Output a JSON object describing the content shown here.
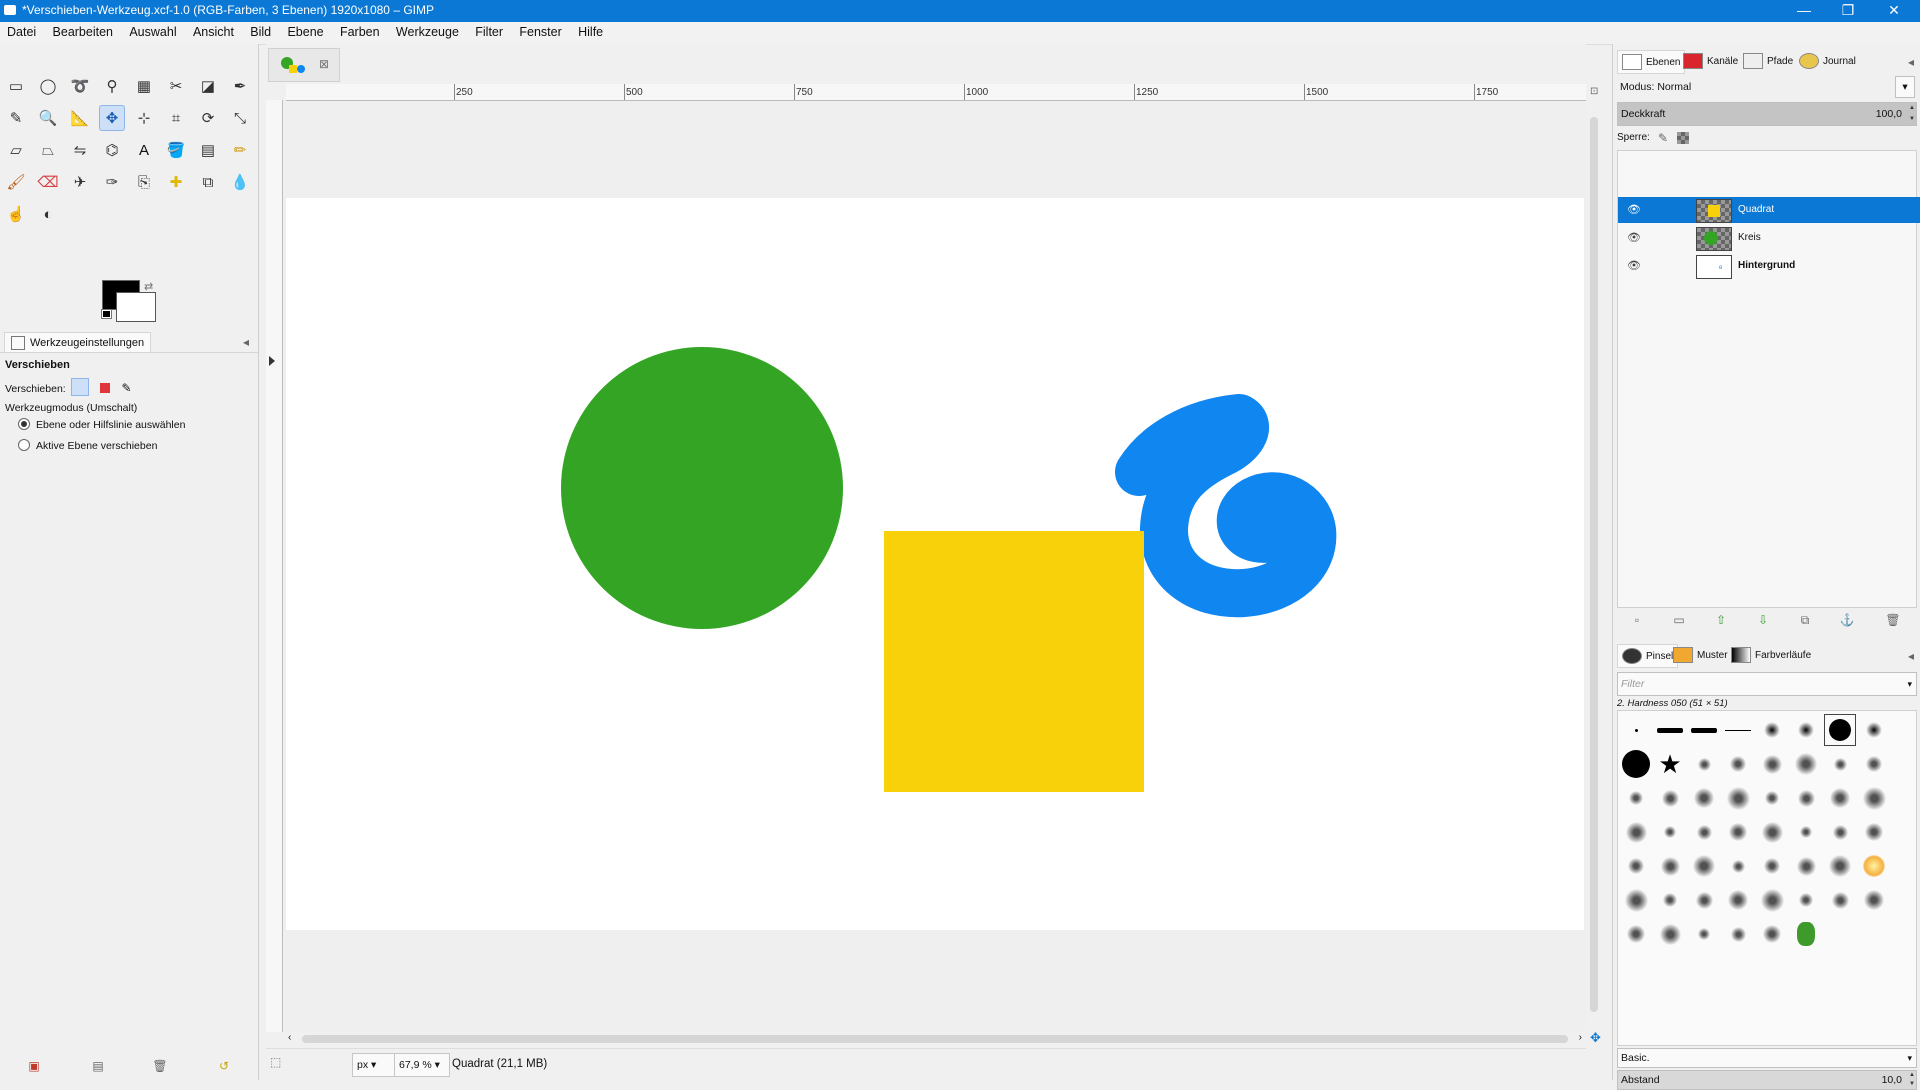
{
  "window": {
    "title": "*Verschieben-Werkzeug.xcf-1.0 (RGB-Farben, 3 Ebenen) 1920x1080 – GIMP",
    "controls": {
      "minimize": "—",
      "restore": "❐",
      "close": "✕"
    }
  },
  "menu": [
    "Datei",
    "Bearbeiten",
    "Auswahl",
    "Ansicht",
    "Bild",
    "Ebene",
    "Farben",
    "Werkzeuge",
    "Filter",
    "Fenster",
    "Hilfe"
  ],
  "toolbox": {
    "tool_icons": [
      "rect-select-icon",
      "ellipse-select-icon",
      "free-select-icon",
      "fuzzy-select-icon",
      "color-select-icon",
      "scissors-icon",
      "foreground-select-icon",
      "paths-icon",
      "color-picker-icon",
      "zoom-icon",
      "measure-icon",
      "move-icon",
      "align-icon",
      "crop-icon",
      "rotate-icon",
      "scale-icon",
      "shear-icon",
      "perspective-icon",
      "flip-icon",
      "cage-icon",
      "text-icon",
      "bucket-fill-icon",
      "blend-icon",
      "pencil-icon",
      "paintbrush-icon",
      "eraser-icon",
      "airbrush-icon",
      "ink-icon",
      "clone-icon",
      "heal-icon",
      "perspective-clone-icon",
      "blur-icon",
      "smudge-icon",
      "dodge-burn-icon"
    ],
    "active_tool": "move-icon",
    "colors": {
      "foreground": "#000000",
      "background": "#ffffff"
    },
    "options_tab": "Werkzeugeinstellungen",
    "options_title": "Verschieben",
    "move_label": "Verschieben:",
    "mode_label": "Werkzeugmodus (Umschalt)",
    "radio_1": "Ebene oder Hilfslinie auswählen",
    "radio_2": "Aktive Ebene verschieben"
  },
  "ruler": {
    "h_ticks": [
      "250",
      "500",
      "750",
      "1000",
      "1250",
      "1500",
      "1750"
    ]
  },
  "canvas": {
    "colors": {
      "circle": "#33a424",
      "square": "#f8d10a",
      "spiral": "#0f86f0",
      "image_bg": "#ffffff"
    }
  },
  "status": {
    "unit": "px",
    "zoom": "67,9 %",
    "info": "Quadrat (21,1 MB)"
  },
  "dock": {
    "tabs": [
      "Ebenen",
      "Kanäle",
      "Pfade",
      "Journal"
    ],
    "mode": "Modus: Normal",
    "opacity_label": "Deckkraft",
    "opacity_value": "100,0",
    "lock_label": "Sperre:",
    "layers": [
      {
        "name": "Quadrat",
        "selected": true
      },
      {
        "name": "Kreis",
        "selected": false
      },
      {
        "name": "Hintergrund",
        "selected": false
      }
    ],
    "brush_tabs": [
      "Pinsel",
      "Muster",
      "Farbverläufe"
    ],
    "filter_placeholder": "Filter",
    "brush_name": "2. Hardness 050 (51 × 51)",
    "brush_preset": "Basic.",
    "spacing_label": "Abstand",
    "spacing_value": "10,0",
    "accent": "#0a78d4"
  }
}
